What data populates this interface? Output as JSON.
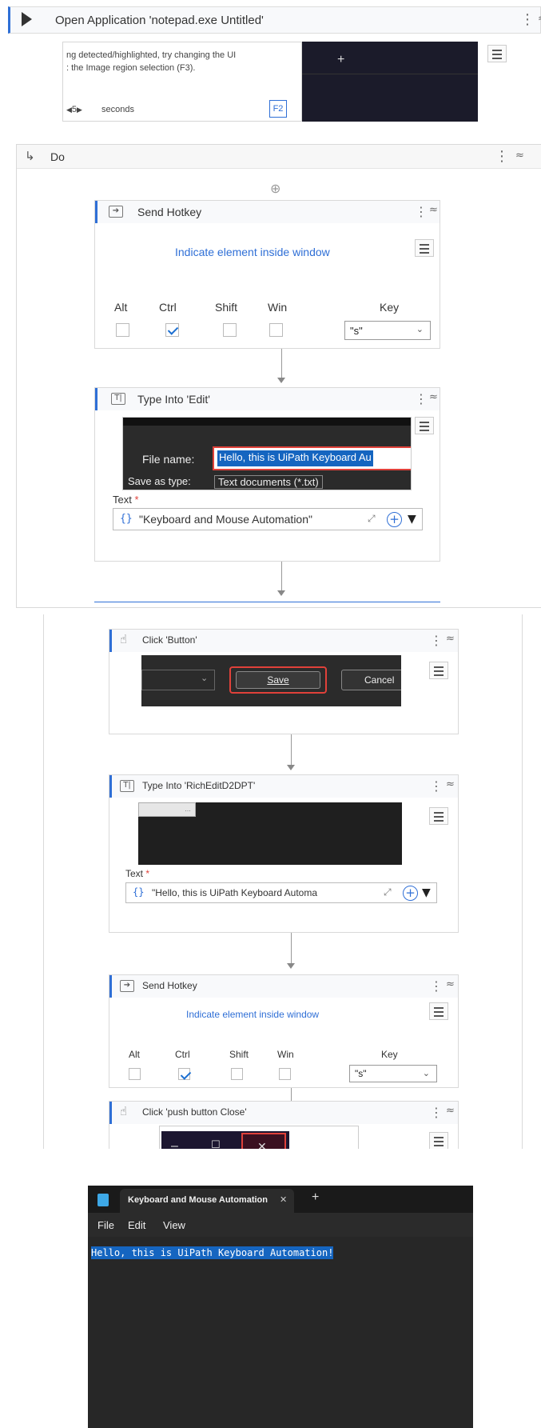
{
  "open_app": {
    "title": "Open Application 'notepad.exe Untitled'",
    "hint_line1": "ng detected/highlighted, try changing the UI",
    "hint_line2": ": the Image region selection (F3).",
    "delay_value": "5",
    "delay_unit": "seconds",
    "hotkey_badge": "F2",
    "preview_tab_plus": "+"
  },
  "do_block": {
    "title": "Do",
    "add_symbol": "⊕"
  },
  "send_hotkey_1": {
    "title": "Send Hotkey",
    "indicate_link": "Indicate element inside window",
    "modifiers": [
      "Alt",
      "Ctrl",
      "Shift",
      "Win"
    ],
    "modifier_checked": [
      false,
      true,
      false,
      false
    ],
    "key_label": "Key",
    "key_value": "\"s\""
  },
  "type_into_edit": {
    "title": "Type Into 'Edit'",
    "preview_file_label": "File name:",
    "preview_file_value": "Hello, this is UiPath Keyboard Au",
    "preview_type_label": "Save as type:",
    "preview_type_value": "Text documents (*.txt)",
    "text_label": "Text",
    "required_mark": "*",
    "text_value": "\"Keyboard and Mouse Automation\""
  },
  "click_button": {
    "title": "Click 'Button'",
    "preview_save": "Save",
    "preview_cancel": "Cancel"
  },
  "type_into_rich": {
    "title": "Type Into 'RichEditD2DPT'",
    "text_label": "Text",
    "required_mark": "*",
    "text_value": "\"Hello, this is UiPath Keyboard Automa"
  },
  "send_hotkey_2": {
    "title": "Send Hotkey",
    "indicate_link": "Indicate element inside window",
    "modifiers": [
      "Alt",
      "Ctrl",
      "Shift",
      "Win"
    ],
    "modifier_checked": [
      false,
      true,
      false,
      false
    ],
    "key_label": "Key",
    "key_value": "\"s\""
  },
  "click_close": {
    "title": "Click 'push button  Close'",
    "preview_minimize": "–",
    "preview_maximize": "☐",
    "preview_close": "✕"
  },
  "notepad": {
    "tab_title": "Keyboard and Mouse Automation",
    "tab_close": "✕",
    "new_tab": "+",
    "menu": [
      "File",
      "Edit",
      "View"
    ],
    "content": "Hello, this is UiPath Keyboard Automation!"
  },
  "colors": {
    "accent": "#2f6fd6",
    "link": "#2f6fd6",
    "highlight_red": "#e0413a",
    "selection": "#1565c0",
    "notepad_bg": "#202020"
  }
}
